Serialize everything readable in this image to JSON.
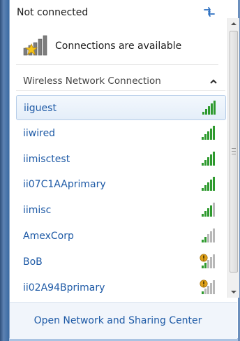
{
  "header": {
    "status": "Not connected",
    "subtitle": "Connections are available"
  },
  "section": {
    "title": "Wireless Network Connection"
  },
  "networks": [
    {
      "name": "iiguest",
      "signal_bars": 5,
      "secured": true,
      "selected": true
    },
    {
      "name": "iiwired",
      "signal_bars": 5,
      "secured": true,
      "selected": false
    },
    {
      "name": "iimisctest",
      "signal_bars": 5,
      "secured": true,
      "selected": false
    },
    {
      "name": "ii07C1AAprimary",
      "signal_bars": 5,
      "secured": true,
      "selected": false
    },
    {
      "name": "iimisc",
      "signal_bars": 4,
      "secured": true,
      "selected": false
    },
    {
      "name": "AmexCorp",
      "signal_bars": 2,
      "secured": true,
      "selected": false
    },
    {
      "name": "BoB",
      "signal_bars": 2,
      "secured": false,
      "selected": false
    },
    {
      "name": "ii02A94Bprimary",
      "signal_bars": 1,
      "secured": false,
      "selected": false
    }
  ],
  "footer": {
    "link": "Open Network and Sharing Center"
  },
  "icons": {
    "refresh": "refresh-icon",
    "network_status": "network-star-icon",
    "collapse": "chevron-up-icon",
    "signal": "signal-bars-icon",
    "warning": "unsecured-shield-icon"
  },
  "colors": {
    "link": "#1e5aa6",
    "signal_active": "#2e9a2e",
    "signal_inactive": "#b8b8b8",
    "warning": "#e0a21a"
  }
}
